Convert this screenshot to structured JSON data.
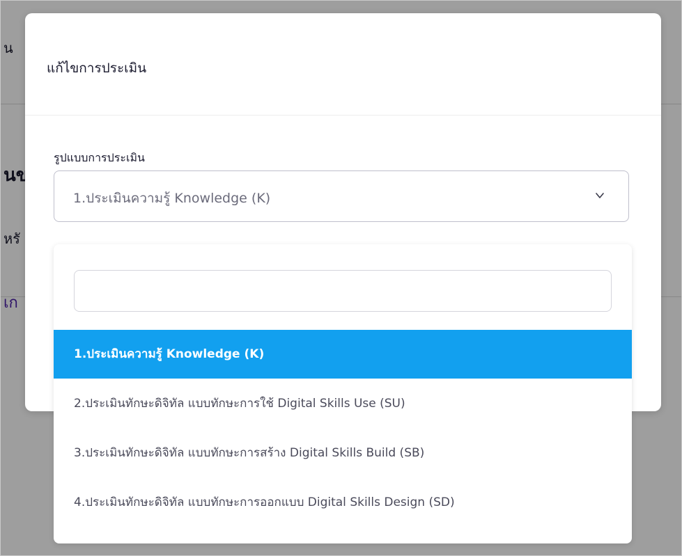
{
  "background": {
    "fragments": [
      "น",
      "นข",
      "หรั",
      "เก"
    ]
  },
  "modal": {
    "title": "แก้ไขการประเมิน",
    "field_label": "รูปแบบการประเมิน",
    "selected_value": "1.ประเมินความรู้ Knowledge (K)",
    "chevron_icon": "chevron-down-icon"
  },
  "dropdown": {
    "search_value": "",
    "options": [
      {
        "label": "1.ประเมินความรู้ Knowledge (K)",
        "selected": true
      },
      {
        "label": "2.ประเมินทักษะดิจิทัล แบบทักษะการใช้ Digital Skills Use (SU)",
        "selected": false
      },
      {
        "label": "3.ประเมินทักษะดิจิทัล แบบทักษะการสร้าง Digital Skills Build (SB)",
        "selected": false
      },
      {
        "label": "4.ประเมินทักษะดิจิทัล แบบทักษะการออกแบบ Digital Skills Design (SD)",
        "selected": false
      }
    ]
  },
  "colors": {
    "selected_option_bg": "#12a0ef",
    "overlay": "rgba(0,0,0,0.38)",
    "accent_text": "#4b1fa8"
  }
}
